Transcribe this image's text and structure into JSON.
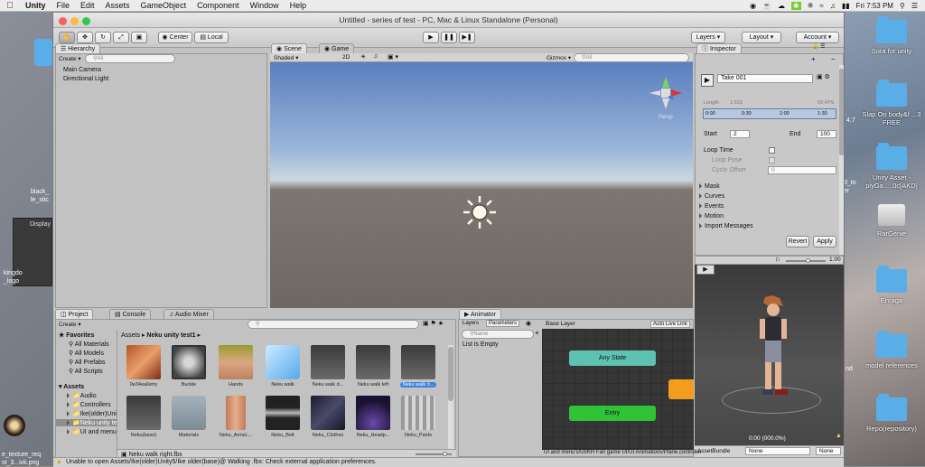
{
  "menubar": {
    "app_name": "Unity",
    "items": [
      "File",
      "Edit",
      "Assets",
      "GameObject",
      "Component",
      "Window",
      "Help"
    ],
    "clock": "Fri 7:53 PM"
  },
  "desktop": {
    "right_icons": [
      "Sora for unity",
      "Slap On body&f....3 FREE",
      "Unity Asset - plyGa.....0c[AKD]",
      "RarGenie",
      "Enraga",
      "model references",
      "Repo(repository)"
    ],
    "left_fragments": [
      "black_ le_stic",
      "kingdo _logo",
      "e_texture_req st_3...ivk.png"
    ],
    "mid_fragments": [
      "4.7",
      "d_to er",
      "nd"
    ]
  },
  "window": {
    "title": "Untitled - series of test - PC, Mac & Linux Standalone (Personal)"
  },
  "toolbar": {
    "center_label": "Center",
    "local_label": "Local",
    "layers_label": "Layers",
    "layout_label": "Layout",
    "account_label": "Account"
  },
  "hierarchy": {
    "tab_label": "Hierarchy",
    "create_label": "Create",
    "search_placeholder": "All",
    "items": [
      "Main Camera",
      "Directional Light"
    ]
  },
  "scene": {
    "tab_scene": "Scene",
    "tab_game": "Game",
    "shading_mode": "Shaded",
    "mode_2d": "2D",
    "gizmos_label": "Gizmos",
    "search_placeholder": "All",
    "persp_label": "Persp"
  },
  "inspector": {
    "tab_label": "Inspector",
    "clip_name": "Take 001",
    "length_label": "Length",
    "length_value": "1.633",
    "fps_label": "60 FPS",
    "timeline_ticks": [
      "0:00",
      "0:30",
      "1:00",
      "1:30"
    ],
    "start_label": "Start",
    "start_value": "2",
    "end_label": "End",
    "end_value": "100",
    "loop_time": "Loop Time",
    "loop_pose": "Loop Pose",
    "cycle_offset": "Cycle Offset",
    "cycle_offset_value": "0",
    "sections": [
      "Mask",
      "Curves",
      "Events",
      "Motion",
      "Import Messages"
    ],
    "revert_label": "Revert",
    "apply_label": "Apply",
    "preview_speed": "1.00",
    "preview_time": "0:00 (000.0%)",
    "assetbundle_label": "AssetBundle",
    "assetbundle_value": "None",
    "assetbundle_variant": "None"
  },
  "project": {
    "tab_project": "Project",
    "tab_console": "Console",
    "tab_audio_mixer": "Audio Mixer",
    "create_label": "Create",
    "favorites_label": "Favorites",
    "favorites": [
      "All Materials",
      "All Models",
      "All Prefabs",
      "All Scripts"
    ],
    "assets_label": "Assets",
    "tree": [
      "Audio",
      "Controllers",
      "Ike(older)Uni",
      "Neku unity te",
      "UI and menu"
    ],
    "breadcrumb_root": "Assets",
    "breadcrumb_current": "Neku unity test1",
    "assets_row1": [
      "0e34ea0etry",
      "Buckle",
      "Hands",
      "Neku walk",
      "Neku walk d...",
      "Neku walk left",
      "Neku walk ri..."
    ],
    "assets_row2": [
      "Neku(base)",
      "Materials",
      "Neku_ArmsL...",
      "Neku_Belt",
      "Neku_Clothes",
      "Neku_Headp...",
      "Neku_Pants"
    ],
    "selected_file": "Neku walk right.fbx"
  },
  "animator": {
    "tab_label": "Animator",
    "layers_tab": "Layers",
    "parameters_tab": "Parameters",
    "base_layer": "Base Layer",
    "auto_live_link": "Auto Live Link",
    "search_placeholder": "Name",
    "list_empty": "List is Empty",
    "any_state": "Any State",
    "entry": "Entry",
    "path": "UI and menu's/UI/KH Fan game UI/UI Animations/Plane.controller"
  },
  "status": {
    "message": "Unable to open Assets/Ike(older)Unity5/Ike older(base)@ Walking .fbx: Check external application preferences."
  },
  "colors": {
    "any_state": "#5ec2b0",
    "entry": "#2fc437",
    "exit_node": "#f39c1e",
    "selected": "#3d82e0"
  }
}
